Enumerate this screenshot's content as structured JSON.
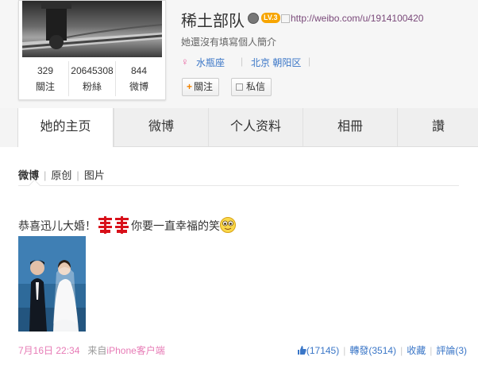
{
  "profile": {
    "name": "稀土部队",
    "level_badge": "LV.3",
    "url": "http://weibo.com/u/1914100420",
    "bio": "她還沒有填寫個人簡介",
    "gender_icon": "female-icon",
    "tags": [
      "水瓶座",
      "北京 朝阳区"
    ],
    "stats": [
      {
        "value": "329",
        "label": "關注"
      },
      {
        "value": "20645308",
        "label": "粉絲"
      },
      {
        "value": "844",
        "label": "微博"
      }
    ],
    "follow_label": "關注",
    "message_label": "私信"
  },
  "tabs": [
    {
      "label": "她的主页",
      "active": true
    },
    {
      "label": "微博"
    },
    {
      "label": "个人资料"
    },
    {
      "label": "相冊"
    },
    {
      "label": "讚"
    }
  ],
  "subtabs": [
    {
      "label": "微博",
      "active": true
    },
    {
      "label": "原创"
    },
    {
      "label": "图片"
    }
  ],
  "post": {
    "text_before": "恭喜迅儿大婚！",
    "text_after": "你要一直幸福的笑",
    "emoji_1": "double-happiness-icon",
    "emoji_2": "smile-emoji-icon",
    "time": "7月16日 22:34",
    "source_prefix": "来自",
    "source": "iPhone客户端",
    "likes": "(17145)",
    "repost": "轉發(3514)",
    "favorite": "收藏",
    "comment": "評論(3)"
  },
  "colors": {
    "link_blue": "#3a76c7",
    "pink": "#e77bb6",
    "orange": "#f08300"
  }
}
